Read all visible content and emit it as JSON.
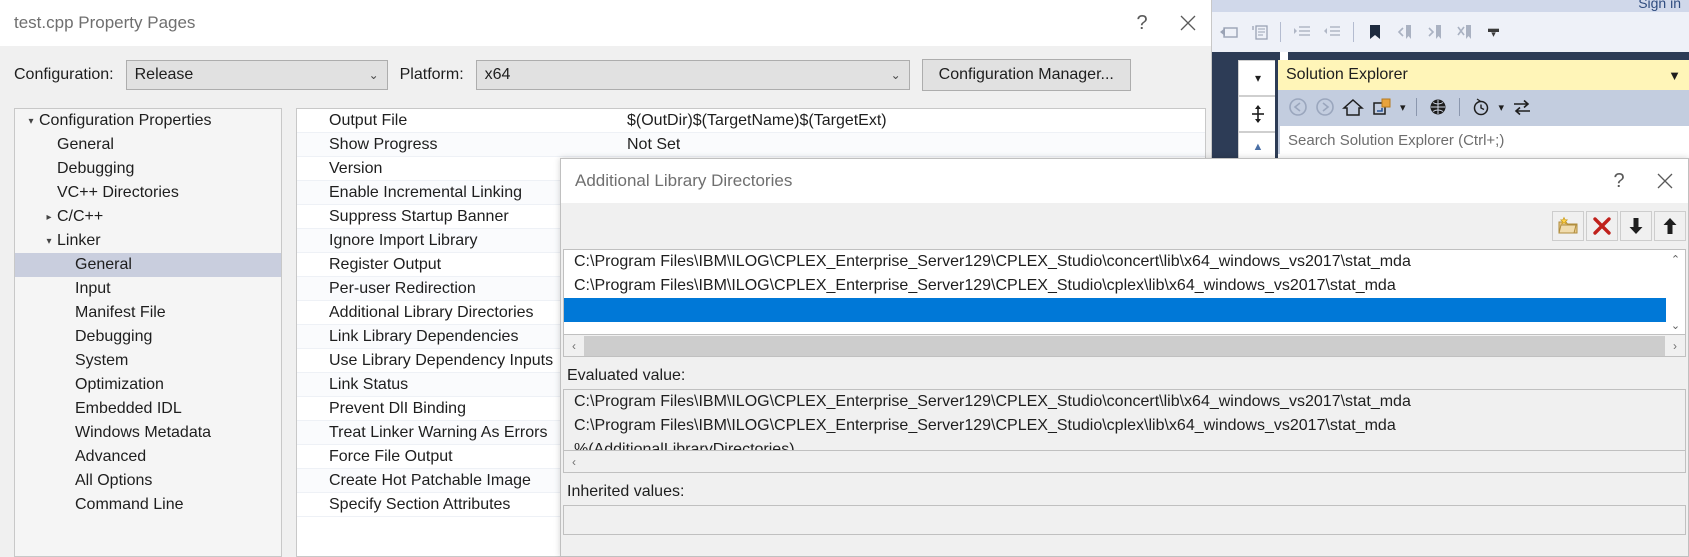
{
  "vs_shell": {
    "signin_label": "Sign in",
    "toolbar_icons": [
      "comment-block-icon",
      "uncomment-block-icon",
      "increase-indent-icon",
      "decrease-indent-icon",
      "toggle-bookmark-icon",
      "previous-bookmark-icon",
      "next-bookmark-icon",
      "clear-bookmarks-icon"
    ],
    "overflow_label": "≡"
  },
  "solution_explorer": {
    "title": "Solution Explorer",
    "dropdown_icon": "chevron-down-icon",
    "toolbar_icons": [
      "back-arrow-icon",
      "forward-arrow-icon",
      "home-icon",
      "sync-with-active-document-icon",
      "dropdown-arrow-icon",
      "show-all-files-icon",
      "pending-changes-icon",
      "pending-changes-dropdown-icon",
      "refresh-icon"
    ],
    "search_placeholder": "Search Solution Explorer (Ctrl+;)"
  },
  "mini_controls": {
    "dropdown_icon": "chevron-down-icon",
    "splitter_icon": "horizontal-splitter-icon",
    "scroll_up_icon": "scroll-up-icon"
  },
  "property_pages": {
    "title": "test.cpp Property Pages",
    "help_label": "?",
    "close_label": "✕",
    "configuration_label": "Configuration:",
    "configuration_value": "Release",
    "platform_label": "Platform:",
    "platform_value": "x64",
    "configuration_manager_label": "Configuration Manager...",
    "chevron": "⌵"
  },
  "tree": {
    "items": [
      {
        "label": "Configuration Properties",
        "indent": 0,
        "twisty": "▾",
        "selected": false
      },
      {
        "label": "General",
        "indent": 1,
        "twisty": "",
        "selected": false
      },
      {
        "label": "Debugging",
        "indent": 1,
        "twisty": "",
        "selected": false
      },
      {
        "label": "VC++ Directories",
        "indent": 1,
        "twisty": "",
        "selected": false
      },
      {
        "label": "C/C++",
        "indent": 1,
        "twisty": "▸",
        "selected": false
      },
      {
        "label": "Linker",
        "indent": 1,
        "twisty": "▾",
        "selected": false
      },
      {
        "label": "General",
        "indent": 2,
        "twisty": "",
        "selected": true
      },
      {
        "label": "Input",
        "indent": 2,
        "twisty": "",
        "selected": false
      },
      {
        "label": "Manifest File",
        "indent": 2,
        "twisty": "",
        "selected": false
      },
      {
        "label": "Debugging",
        "indent": 2,
        "twisty": "",
        "selected": false
      },
      {
        "label": "System",
        "indent": 2,
        "twisty": "",
        "selected": false
      },
      {
        "label": "Optimization",
        "indent": 2,
        "twisty": "",
        "selected": false
      },
      {
        "label": "Embedded IDL",
        "indent": 2,
        "twisty": "",
        "selected": false
      },
      {
        "label": "Windows Metadata",
        "indent": 2,
        "twisty": "",
        "selected": false
      },
      {
        "label": "Advanced",
        "indent": 2,
        "twisty": "",
        "selected": false
      },
      {
        "label": "All Options",
        "indent": 2,
        "twisty": "",
        "selected": false
      },
      {
        "label": "Command Line",
        "indent": 2,
        "twisty": "",
        "selected": false
      }
    ]
  },
  "property_grid": {
    "rows": [
      {
        "name": "Output File",
        "value": "$(OutDir)$(TargetName)$(TargetExt)"
      },
      {
        "name": "Show Progress",
        "value": "Not Set"
      },
      {
        "name": "Version",
        "value": ""
      },
      {
        "name": "Enable Incremental Linking",
        "value": ""
      },
      {
        "name": "Suppress Startup Banner",
        "value": ""
      },
      {
        "name": "Ignore Import Library",
        "value": ""
      },
      {
        "name": "Register Output",
        "value": ""
      },
      {
        "name": "Per-user Redirection",
        "value": ""
      },
      {
        "name": "Additional Library Directories",
        "value": ""
      },
      {
        "name": "Link Library Dependencies",
        "value": ""
      },
      {
        "name": "Use Library Dependency Inputs",
        "value": ""
      },
      {
        "name": "Link Status",
        "value": ""
      },
      {
        "name": "Prevent DlI Binding",
        "value": ""
      },
      {
        "name": "Treat Linker Warning As Errors",
        "value": ""
      },
      {
        "name": "Force File Output",
        "value": ""
      },
      {
        "name": "Create Hot Patchable Image",
        "value": ""
      },
      {
        "name": "Specify Section Attributes",
        "value": ""
      }
    ]
  },
  "ald_dialog": {
    "title": "Additional Library Directories",
    "help_label": "?",
    "close_label": "✕",
    "toolbar_buttons": [
      {
        "name": "new-folder-icon",
        "tooltip": "New Line"
      },
      {
        "name": "delete-icon",
        "tooltip": "Delete"
      },
      {
        "name": "move-down-icon",
        "tooltip": "Move Down"
      },
      {
        "name": "move-up-icon",
        "tooltip": "Move Up"
      }
    ],
    "list_entries": [
      {
        "text": "C:\\Program Files\\IBM\\ILOG\\CPLEX_Enterprise_Server129\\CPLEX_Studio\\concert\\lib\\x64_windows_vs2017\\stat_mda",
        "selected": false
      },
      {
        "text": "C:\\Program Files\\IBM\\ILOG\\CPLEX_Enterprise_Server129\\CPLEX_Studio\\cplex\\lib\\x64_windows_vs2017\\stat_mda",
        "selected": false
      },
      {
        "text": "",
        "selected": true
      }
    ],
    "scroll_up_icon": "scroll-up-icon",
    "scroll_down_icon": "scroll-down-icon",
    "hscroll_left_icon": "scroll-left-icon",
    "hscroll_right_icon": "scroll-right-icon",
    "evaluated_label": "Evaluated value:",
    "evaluated_lines": [
      "C:\\Program Files\\IBM\\ILOG\\CPLEX_Enterprise_Server129\\CPLEX_Studio\\concert\\lib\\x64_windows_vs2017\\stat_mda",
      "C:\\Program Files\\IBM\\ILOG\\CPLEX_Enterprise_Server129\\CPLEX_Studio\\cplex\\lib\\x64_windows_vs2017\\stat_mda",
      "%(AdditionalLibraryDirectories)"
    ],
    "inherited_label": "Inherited values:"
  },
  "colors": {
    "selection_blue": "#0078d7",
    "tree_selection": "#c9cede",
    "solution_explorer_title": "#fff5b8",
    "vs_dark": "#2d3c56",
    "vs_panel": "#c3cddf"
  }
}
